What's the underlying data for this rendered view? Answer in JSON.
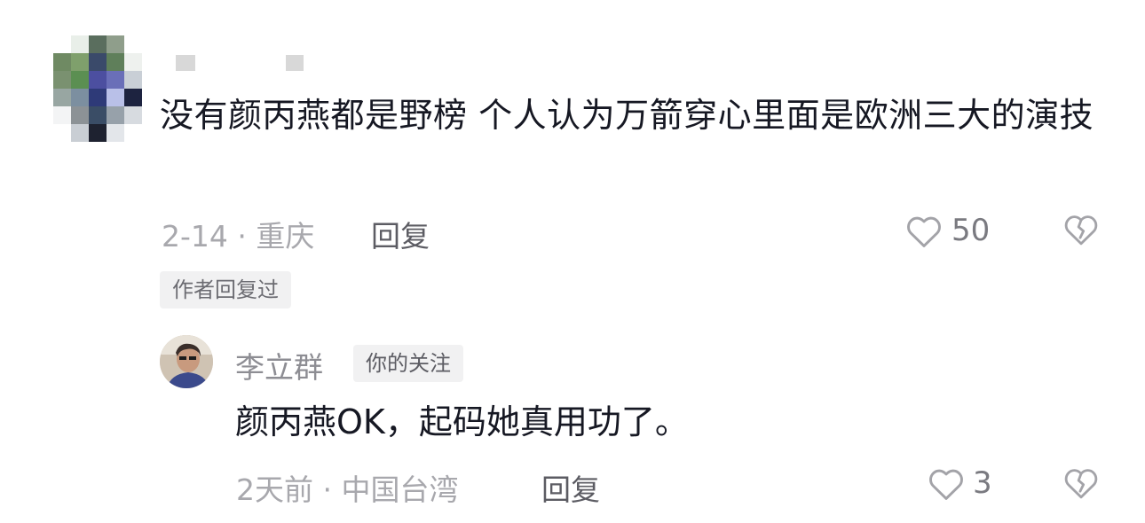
{
  "comment": {
    "text": "没有颜丙燕都是野榜 个人认为万箭穿心里面是欧洲三大的演技",
    "date_location": "2-14 · 重庆",
    "reply_label": "回复",
    "like_count": "50",
    "author_tag": "作者回复过"
  },
  "reply": {
    "user_name": "李立群",
    "follow_badge": "你的关注",
    "text": "颜丙燕OK，起码她真用功了。",
    "date_location": "2天前 · 中国台湾",
    "reply_label": "回复",
    "like_count": "3"
  },
  "colors": {
    "primary_text": "#161823",
    "secondary_text": "#a8a8ad",
    "tag_background": "#f1f1f2"
  },
  "icons": {
    "like": "heart-outline-icon",
    "dislike": "broken-heart-icon"
  }
}
